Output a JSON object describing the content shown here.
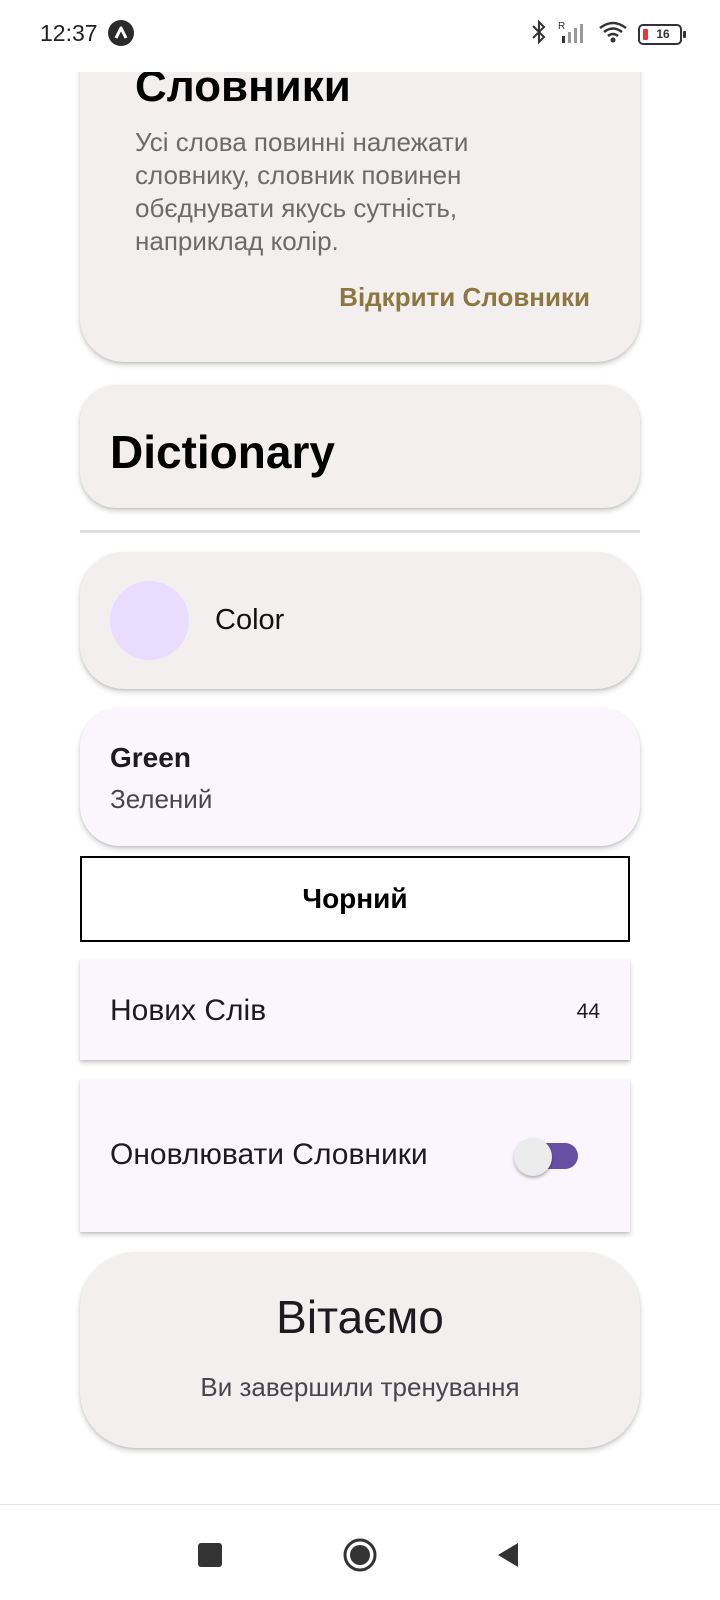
{
  "status_bar": {
    "time": "12:37",
    "battery_level": "16",
    "icons": [
      "app-badge-icon",
      "bluetooth-icon",
      "signal-icon",
      "wifi-icon",
      "battery-icon"
    ]
  },
  "dictionaries_card": {
    "title": "Словники",
    "description": "Усі слова повинні належати словнику, словник повинен обєднувати якусь сутність, наприклад колір.",
    "open_link": "Відкрити Словники"
  },
  "dictionary_card": {
    "title": "Dictionary"
  },
  "color_card": {
    "label": "Color",
    "swatch_color": "#eadcff"
  },
  "word_card": {
    "word": "Green",
    "translation": "Зелений"
  },
  "black_button": {
    "label": "Чорний"
  },
  "new_words_row": {
    "label": "Нових Слів",
    "count": "44"
  },
  "update_row": {
    "label": "Оновлювати Словники",
    "toggle_on": false,
    "accent_color": "#6750a4"
  },
  "welcome_card": {
    "title": "Вітаємо",
    "subtitle": "Ви завершили тренування"
  },
  "nav_bar": {
    "buttons": [
      "recents-icon",
      "home-icon",
      "back-icon"
    ]
  }
}
